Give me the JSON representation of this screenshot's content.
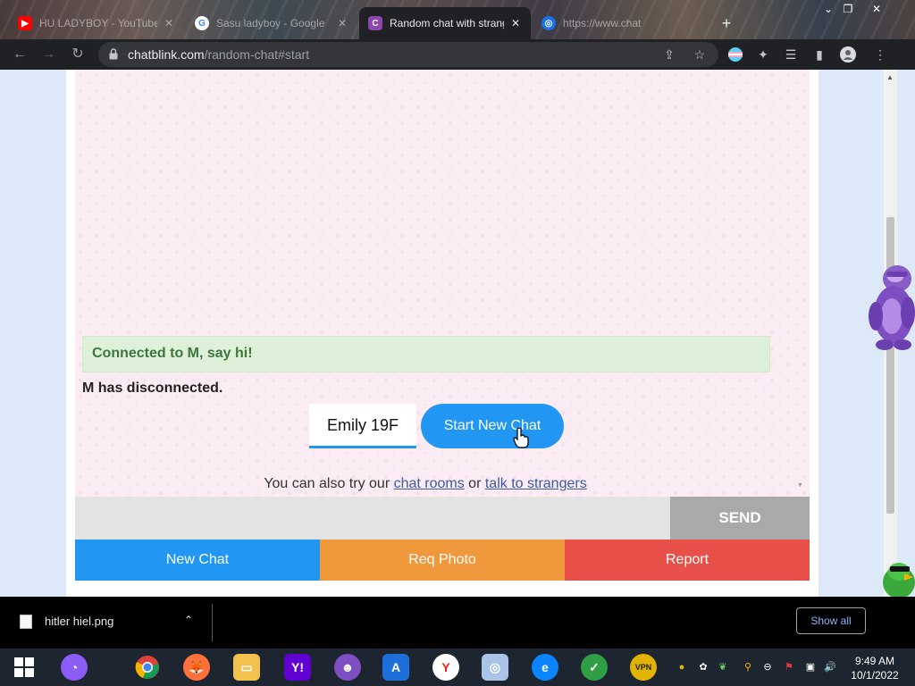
{
  "browser": {
    "tabs": [
      {
        "label": "HU LADYBOY - YouTube",
        "icon": "youtube-icon",
        "active": false
      },
      {
        "label": "Sasu ladyboy - Google",
        "icon": "google-icon",
        "active": false
      },
      {
        "label": "Random chat with strangers",
        "icon": "chatblink-icon",
        "active": true
      },
      {
        "label": "https://www.chat",
        "icon": "globe-icon",
        "active": false
      }
    ],
    "new_tab_symbol": "+",
    "url_domain": "chatblink.com",
    "url_path": "/random-chat#start"
  },
  "chat": {
    "connected_message": "Connected to M, say hi!",
    "disconnected_message": "M has disconnected.",
    "name_value": "Emily 19F",
    "start_button": "Start New Chat",
    "alt_prefix": "You can also try our ",
    "alt_link1": "chat rooms",
    "alt_middle": " or ",
    "alt_link2": "talk to strangers",
    "message_placeholder": "",
    "send_button": "SEND",
    "actions": [
      {
        "label": "New Chat",
        "color": "#2196f3"
      },
      {
        "label": "Req Photo",
        "color": "#f0983c"
      },
      {
        "label": "Report",
        "color": "#e8504a"
      }
    ]
  },
  "downloads": {
    "file_name": "hitler hiel.png",
    "show_all": "Show all"
  },
  "taskbar": {
    "time": "9:49 AM",
    "date": "10/1/2022"
  },
  "colors": {
    "accent": "#2196f3",
    "connected_bg": "#dff0d8",
    "connected_text": "#3c763d",
    "chat_bg": "#fbecf3"
  }
}
